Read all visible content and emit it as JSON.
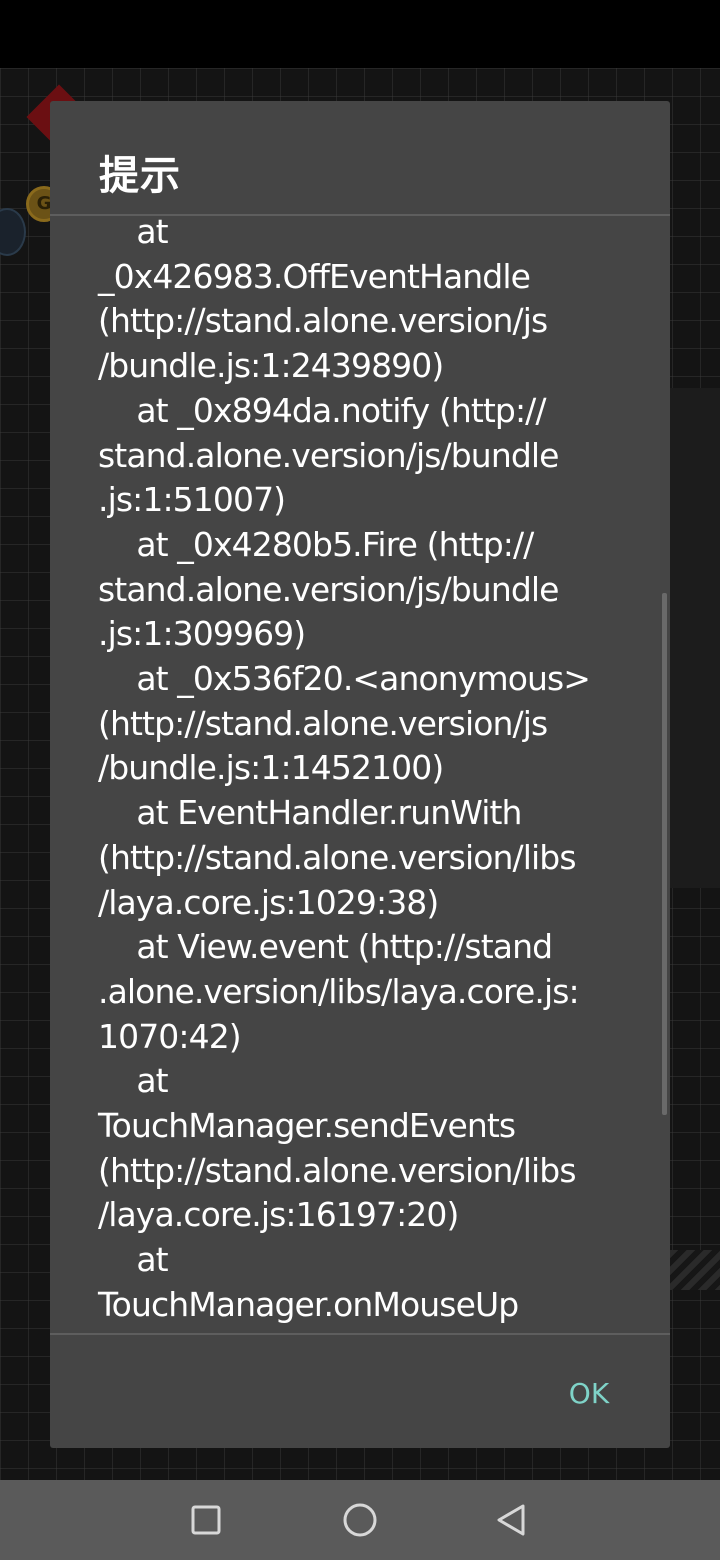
{
  "dialog": {
    "title": "提示",
    "message_lines": [
      "    at",
      "_0x426983.OffEventHandle",
      "(http://stand.alone.version/js",
      "/bundle.js:1:2439890)",
      "    at _0x894da.notify (http://",
      "stand.alone.version/js/bundle",
      ".js:1:51007)",
      "    at _0x4280b5.Fire (http://",
      "stand.alone.version/js/bundle",
      ".js:1:309969)",
      "    at _0x536f20.<anonymous>",
      "(http://stand.alone.version/js",
      "/bundle.js:1:1452100)",
      "    at EventHandler.runWith",
      "(http://stand.alone.version/libs",
      "/laya.core.js:1029:38)",
      "    at View.event (http://stand",
      ".alone.version/libs/laya.core.js:",
      "1070:42)",
      "    at",
      "TouchManager.sendEvents",
      "(http://stand.alone.version/libs",
      "/laya.core.js:16197:20)",
      "    at",
      "TouchManager.onMouseUp"
    ],
    "ok_label": "OK",
    "accent_color": "#7fd3c8"
  },
  "background": {
    "coin_letter": "G"
  },
  "nav_bar": {
    "buttons": [
      "recents-icon",
      "home-icon",
      "back-icon"
    ]
  }
}
